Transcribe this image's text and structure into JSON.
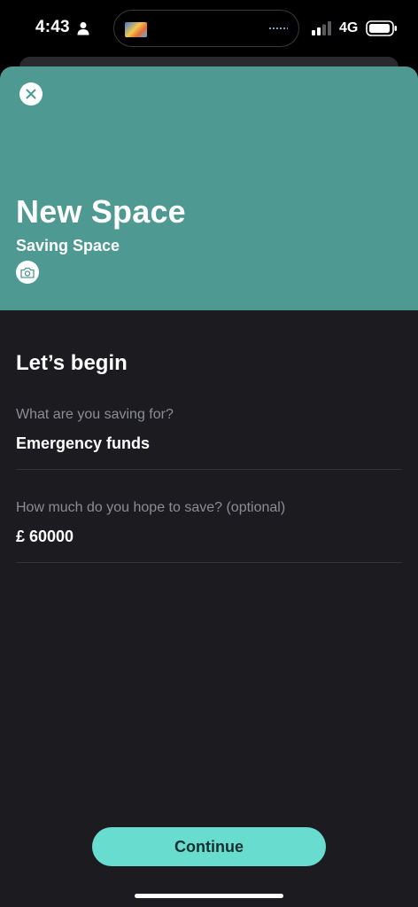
{
  "status_bar": {
    "time": "4:43",
    "network": "4G"
  },
  "header": {
    "title": "New Space",
    "subtitle": "Saving Space",
    "background_color": "#4e9a92"
  },
  "form": {
    "title": "Let’s begin",
    "goal": {
      "label": "What are you saving for?",
      "value": "Emergency funds"
    },
    "amount": {
      "label": "How much do you hope to save? (optional)",
      "value": "£ 60000"
    }
  },
  "actions": {
    "continue_label": "Continue",
    "accent_color": "#69dcd0"
  },
  "icons": {
    "close": "close-icon",
    "camera": "camera-icon",
    "person": "person-icon",
    "signal": "signal-icon",
    "battery": "battery-icon"
  }
}
